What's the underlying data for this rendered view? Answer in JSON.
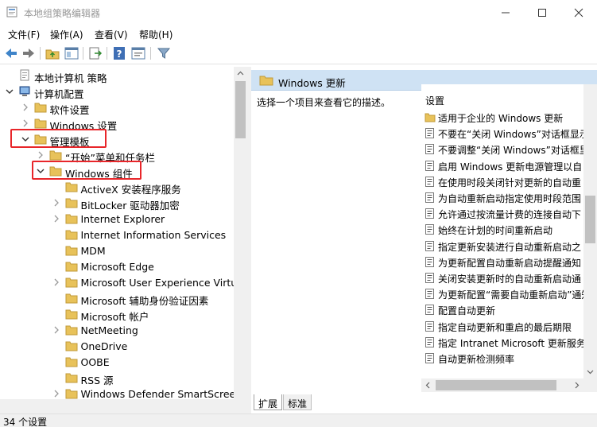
{
  "window": {
    "title": "本地组策略编辑器"
  },
  "menu": [
    "文件(F)",
    "操作(A)",
    "查看(V)",
    "帮助(H)"
  ],
  "toolbar": {
    "buttons": [
      "back-arrow-icon",
      "forward-arrow-icon",
      "up-folder-icon",
      "show-hide-tree-icon",
      "export-list-icon",
      "help-icon",
      "properties-icon",
      "filter-icon"
    ]
  },
  "tree": {
    "items": [
      {
        "label": "本地计算机 策略",
        "icon": "computer-policy-icon",
        "expander": "none"
      },
      {
        "label": "计算机配置",
        "icon": "computer-icon",
        "expander": "expanded"
      },
      {
        "label": "软件设置",
        "icon": "folder-icon",
        "expander": "collapsed"
      },
      {
        "label": "Windows 设置",
        "icon": "folder-icon",
        "expander": "collapsed"
      },
      {
        "label": "管理模板",
        "icon": "folder-icon",
        "expander": "expanded"
      },
      {
        "label": "“开始”菜单和任务栏",
        "icon": "folder-icon",
        "expander": "collapsed"
      },
      {
        "label": "Windows 组件",
        "icon": "folder-icon",
        "expander": "expanded"
      },
      {
        "label": "ActiveX 安装程序服务",
        "icon": "folder-icon",
        "expander": "none"
      },
      {
        "label": "BitLocker 驱动器加密",
        "icon": "folder-icon",
        "expander": "collapsed"
      },
      {
        "label": "Internet Explorer",
        "icon": "folder-icon",
        "expander": "collapsed"
      },
      {
        "label": "Internet Information Services",
        "icon": "folder-icon",
        "expander": "none"
      },
      {
        "label": "MDM",
        "icon": "folder-icon",
        "expander": "none"
      },
      {
        "label": "Microsoft Edge",
        "icon": "folder-icon",
        "expander": "none"
      },
      {
        "label": "Microsoft User Experience Virtua",
        "icon": "folder-icon",
        "expander": "collapsed"
      },
      {
        "label": "Microsoft 辅助身份验证因素",
        "icon": "folder-icon",
        "expander": "none"
      },
      {
        "label": "Microsoft 帐户",
        "icon": "folder-icon",
        "expander": "none"
      },
      {
        "label": "NetMeeting",
        "icon": "folder-icon",
        "expander": "collapsed"
      },
      {
        "label": "OneDrive",
        "icon": "folder-icon",
        "expander": "none"
      },
      {
        "label": "OOBE",
        "icon": "folder-icon",
        "expander": "none"
      },
      {
        "label": "RSS 源",
        "icon": "folder-icon",
        "expander": "none"
      },
      {
        "label": "Windows Defender SmartScreen",
        "icon": "folder-icon",
        "expander": "collapsed"
      }
    ]
  },
  "right_pane": {
    "header_title": "Windows 更新",
    "description_prompt": "选择一个项目来查看它的描述。",
    "column_header": "设置",
    "settings": [
      {
        "label": "适用于企业的 Windows 更新",
        "icon": "folder-icon"
      },
      {
        "label": "不要在“关闭 Windows”对话框显示",
        "icon": "policy-setting-icon"
      },
      {
        "label": "不要调整“关闭 Windows”对话框里",
        "icon": "policy-setting-icon"
      },
      {
        "label": "启用 Windows 更新电源管理以自",
        "icon": "policy-setting-icon"
      },
      {
        "label": "在使用时段关闭针对更新的自动重",
        "icon": "policy-setting-icon"
      },
      {
        "label": "为自动重新启动指定使用时段范围",
        "icon": "policy-setting-icon"
      },
      {
        "label": "允许通过按流量计费的连接自动下",
        "icon": "policy-setting-icon"
      },
      {
        "label": "始终在计划的时间重新启动",
        "icon": "policy-setting-icon"
      },
      {
        "label": "指定更新安装进行自动重新启动之",
        "icon": "policy-setting-icon"
      },
      {
        "label": "为更新配置自动重新启动提醒通知",
        "icon": "policy-setting-icon"
      },
      {
        "label": "关闭安装更新时的自动重新启动通",
        "icon": "policy-setting-icon"
      },
      {
        "label": "为更新配置“需要自动重新启动”通知",
        "icon": "policy-setting-icon"
      },
      {
        "label": "配置自动更新",
        "icon": "policy-setting-icon"
      },
      {
        "label": "指定自动更新和重启的最后期限",
        "icon": "policy-setting-icon"
      },
      {
        "label": "指定 Intranet Microsoft 更新服务",
        "icon": "policy-setting-icon"
      },
      {
        "label": "自动更新检测频率",
        "icon": "policy-setting-icon"
      }
    ],
    "tabs": [
      "扩展",
      "标准"
    ]
  },
  "status": {
    "text": "34 个设置"
  },
  "colors": {
    "highlight_box": "#e8262a",
    "header_bg": "#cfe2f4",
    "folder": "#e8c25a"
  }
}
